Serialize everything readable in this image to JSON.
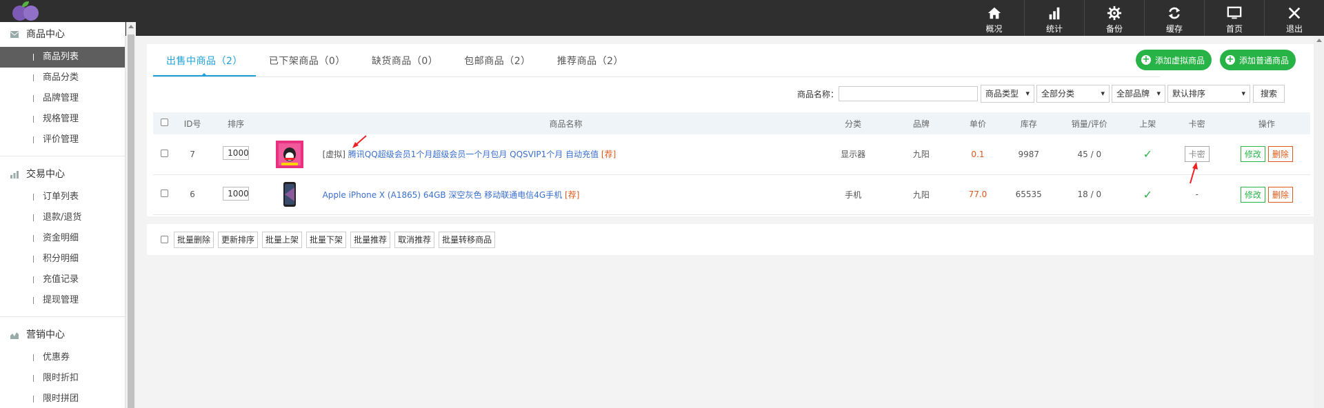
{
  "topnav": [
    {
      "label": "概况",
      "icon": "home-icon"
    },
    {
      "label": "统计",
      "icon": "bar-chart-icon"
    },
    {
      "label": "备份",
      "icon": "gear-icon"
    },
    {
      "label": "缓存",
      "icon": "refresh-icon"
    },
    {
      "label": "首页",
      "icon": "monitor-icon"
    },
    {
      "label": "退出",
      "icon": "close-icon"
    }
  ],
  "sidebar": {
    "sections": [
      {
        "title": "商品中心",
        "icon": "mail-icon",
        "items": [
          "商品列表",
          "商品分类",
          "品牌管理",
          "规格管理",
          "评价管理"
        ]
      },
      {
        "title": "交易中心",
        "icon": "bar-chart-icon",
        "items": [
          "订单列表",
          "退款/退货",
          "资金明细",
          "积分明细",
          "充值记录",
          "提现管理"
        ]
      },
      {
        "title": "营销中心",
        "icon": "area-chart-icon",
        "items": [
          "优惠券",
          "限时折扣",
          "限时拼团"
        ]
      }
    ],
    "active_item": "商品列表"
  },
  "tabs": [
    "出售中商品（2）",
    "已下架商品（0）",
    "缺货商品（0）",
    "包邮商品（2）",
    "推荐商品（2）"
  ],
  "buttons": {
    "add_virtual": "添加虚拟商品",
    "add_normal": "添加普通商品",
    "search": "搜索"
  },
  "filter": {
    "name_label": "商品名称：",
    "type": "商品类型",
    "category": "全部分类",
    "brand": "全部品牌",
    "sort": "默认排序"
  },
  "table": {
    "headers": [
      "ID号",
      "排序",
      "商品名称",
      "分类",
      "品牌",
      "单价",
      "库存",
      "销量/评价",
      "上架",
      "卡密",
      "操作"
    ],
    "rows": [
      {
        "id": "7",
        "sort": "1000",
        "prefix": "[虚拟]",
        "name": "腾讯QQ超级会员1个月超级会员一个月包月 QQSVIP1个月 自动充值",
        "tag": "[荐]",
        "category": "显示器",
        "brand": "九阳",
        "price": "0.1",
        "stock": "9987",
        "sales": "45 / 0",
        "card": "卡密",
        "edit": "修改",
        "delete": "删除"
      },
      {
        "id": "6",
        "sort": "1000",
        "prefix": "",
        "name": "Apple iPhone X (A1865) 64GB 深空灰色 移动联通电信4G手机",
        "tag": "[荐]",
        "category": "手机",
        "brand": "九阳",
        "price": "77.0",
        "stock": "65535",
        "sales": "18 / 0",
        "card": "-",
        "edit": "修改",
        "delete": "删除"
      }
    ]
  },
  "bulk": [
    "批量删除",
    "更新排序",
    "批量上架",
    "批量下架",
    "批量推荐",
    "取消推荐",
    "批量转移商品"
  ],
  "colors": {
    "accent": "#1ea0d8",
    "green": "#27b346",
    "orange": "#e05a1a",
    "topbar": "#2f2f2f"
  }
}
